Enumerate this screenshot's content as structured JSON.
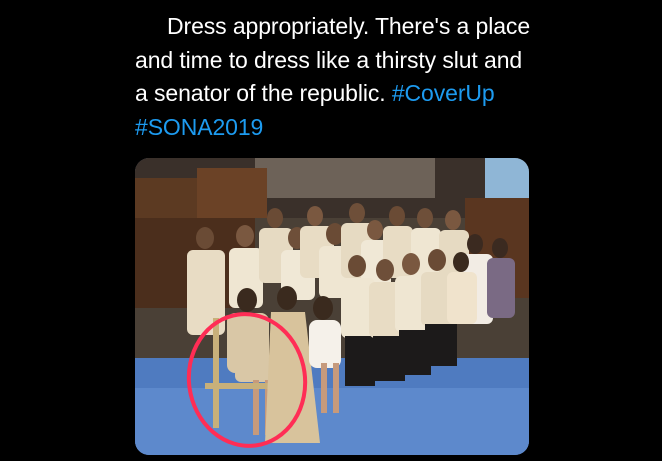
{
  "tweet": {
    "text_lines": [
      "Dress appropriately. There's a place",
      "and time to dress like a thirsty slut and",
      "a senator of the republic. "
    ],
    "hashtags": [
      "#CoverUp",
      "#SONA2019"
    ]
  },
  "media": {
    "type": "photo",
    "annotation": "red-circle"
  },
  "colors": {
    "background": "#000000",
    "text": "#ffffff",
    "hashtag": "#1d9bf0",
    "circle": "#ff2d55"
  }
}
